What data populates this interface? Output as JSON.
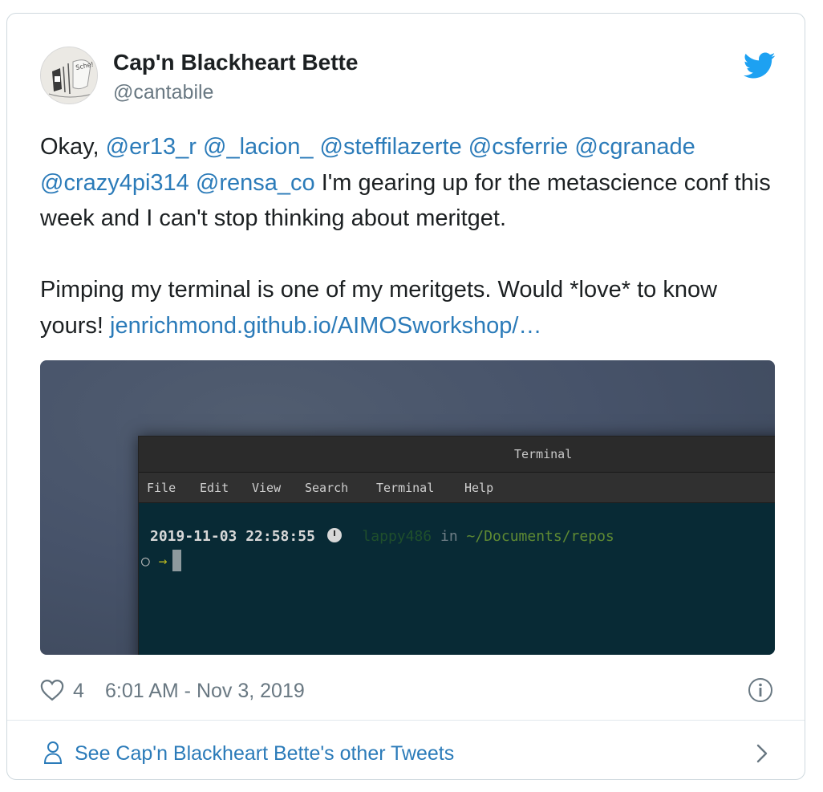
{
  "author": {
    "name": "Cap'n Blackheart Bette",
    "handle": "@cantabile",
    "avatar_text": "Sche!"
  },
  "tweet": {
    "intro": "Okay,",
    "mentions": [
      "@er13_r",
      "@_lacion_",
      "@steffilazerte",
      "@csferrie",
      "@cgranade",
      "@crazy4pi314",
      "@rensa_co"
    ],
    "text1": "I'm gearing up for the metascience conf this week and I can't stop thinking about meritget.",
    "text2": "Pimping my terminal is one of my meritgets. Would *love* to know yours!",
    "link": "jenrichmond.github.io/AIMOSworkshop/…"
  },
  "terminal": {
    "title": "Terminal",
    "menu": [
      "File",
      "Edit",
      "View",
      "Search",
      "Terminal",
      "Help"
    ],
    "timestamp": "2019-11-03 22:58:55",
    "host": "lappy486",
    "in_word": "in",
    "path": "~/Documents/repos",
    "prompt_circle": "○",
    "prompt_arrow": "→"
  },
  "footer": {
    "like_count": "4",
    "time": "6:01 AM - Nov 3, 2019",
    "see_others": "See Cap'n Blackheart Bette's other Tweets"
  },
  "colors": {
    "link": "#2b7bb9",
    "twitter_blue": "#1da1f2",
    "muted": "#697882"
  },
  "icons": [
    "twitter-bird-icon",
    "heart-icon",
    "info-icon",
    "person-icon",
    "chevron-right-icon",
    "clock-icon"
  ]
}
